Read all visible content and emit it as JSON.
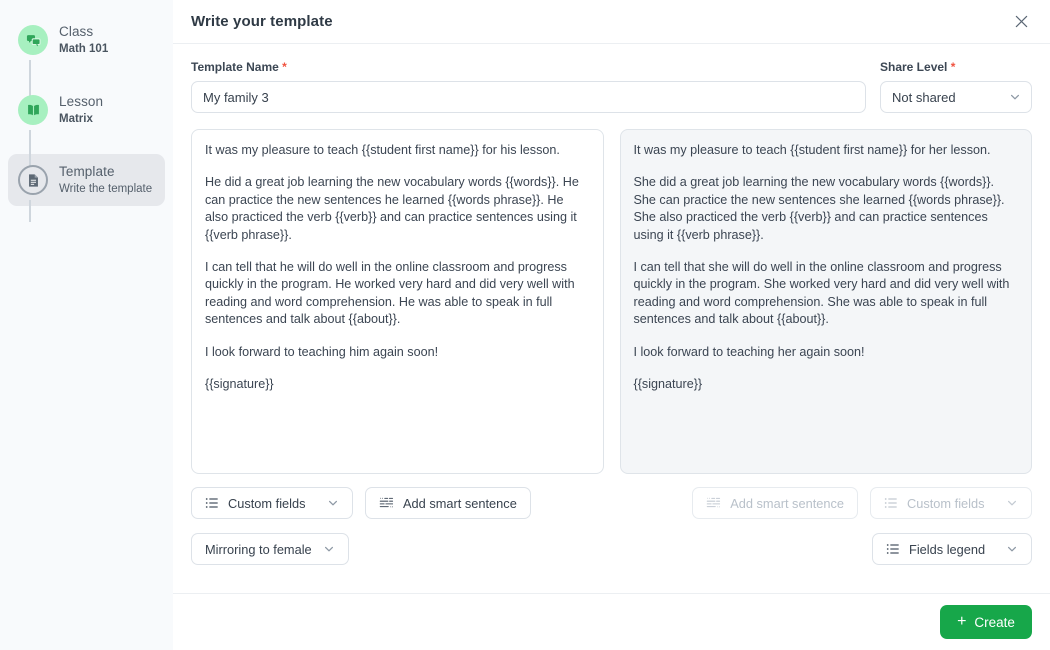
{
  "sidebar": {
    "steps": [
      {
        "icon": "chat-class-icon",
        "title": "Class",
        "subtitle": "Math 101",
        "state": "done"
      },
      {
        "icon": "book-icon",
        "title": "Lesson",
        "subtitle": "Matrix",
        "state": "done"
      },
      {
        "icon": "document-icon",
        "title": "Template",
        "subtitle": "Write the template",
        "state": "current"
      }
    ]
  },
  "header": {
    "title": "Write your template",
    "close_label": "×"
  },
  "form": {
    "template_name": {
      "label": "Template Name",
      "required_mark": "*",
      "value": "My family 3",
      "placeholder": "Template Name"
    },
    "share_level": {
      "label": "Share Level",
      "required_mark": "*",
      "value": "Not shared"
    }
  },
  "editors": {
    "male": {
      "paragraphs": [
        "It was my pleasure to teach {{student first name}} for his lesson.",
        "He did a great job learning the new vocabulary words {{words}}. He can practice the new sentences he learned {{words phrase}}. He also practiced the verb {{verb}} and can practice sentences using it {{verb phrase}}.",
        "I can tell that he will do well in the online classroom and progress quickly in the program. He worked very hard and did very well with reading and word comprehension. He was able to speak in full sentences and talk about {{about}}.",
        "I look forward to teaching him again soon!",
        "{{signature}}"
      ]
    },
    "female": {
      "paragraphs": [
        "It was my pleasure to teach {{student first name}} for her lesson.",
        "She did a great job learning the new vocabulary words {{words}}. She can practice the new sentences she learned {{words phrase}}. She also practiced the verb {{verb}} and can practice sentences using it {{verb phrase}}.",
        "I can tell that she will do well in the online classroom and progress quickly in the program. She worked very hard and did very well with reading and word comprehension. She was able to speak in full sentences and talk about {{about}}.",
        "I look forward to teaching her again soon!",
        "{{signature}}"
      ]
    }
  },
  "toolbar": {
    "custom_fields_left": "Custom fields",
    "add_smart_sentence_left": "Add smart sentence",
    "add_smart_sentence_right": "Add smart sentence",
    "custom_fields_right": "Custom fields",
    "mirroring": "Mirroring to female",
    "fields_legend": "Fields legend"
  },
  "footer": {
    "create_label": "Create",
    "create_icon": "plus-icon"
  },
  "colors": {
    "accent_green": "#17a74a",
    "step_done": "#a7f0c0",
    "required_red": "#f05340",
    "sidebar_bg": "#f8fafc",
    "mirrored_panel_bg": "#f4f6f8"
  }
}
